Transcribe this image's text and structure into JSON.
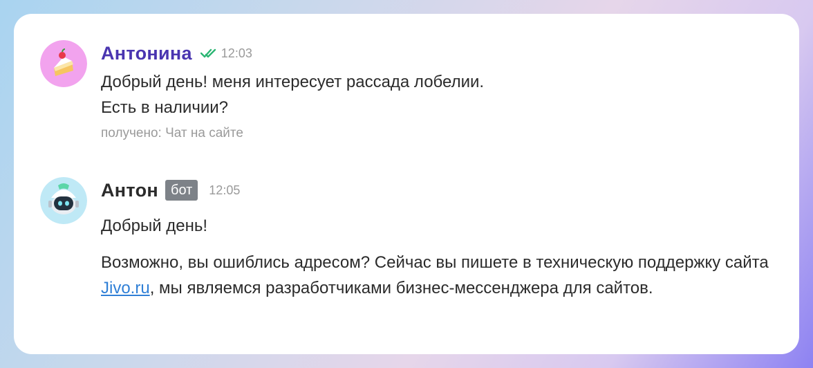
{
  "messages": [
    {
      "sender": "Антонина",
      "time": "12:03",
      "status_icon": "double-check-icon",
      "lines": [
        "Добрый день! меня интересует рассада лобелии.",
        "Есть в наличии?"
      ],
      "source": "получено: Чат на сайте",
      "avatar": "cake-avatar",
      "name_color": "#4a35b0"
    },
    {
      "sender": "Антон",
      "badge": "бот",
      "time": "12:05",
      "avatar": "robot-avatar",
      "greeting": "Добрый день!",
      "body_before_link": "Возможно, вы ошиблись адресом? Сейчас вы пишете в техническую поддержку сайта ",
      "link_text": "Jivo.ru",
      "body_after_link": ", мы являемся разработчиками бизнес-мессенджера для сайтов."
    }
  ],
  "colors": {
    "accent": "#4a35b0",
    "link": "#2f7fd6",
    "badge_bg": "#7d8288",
    "check": "#2bb673"
  }
}
